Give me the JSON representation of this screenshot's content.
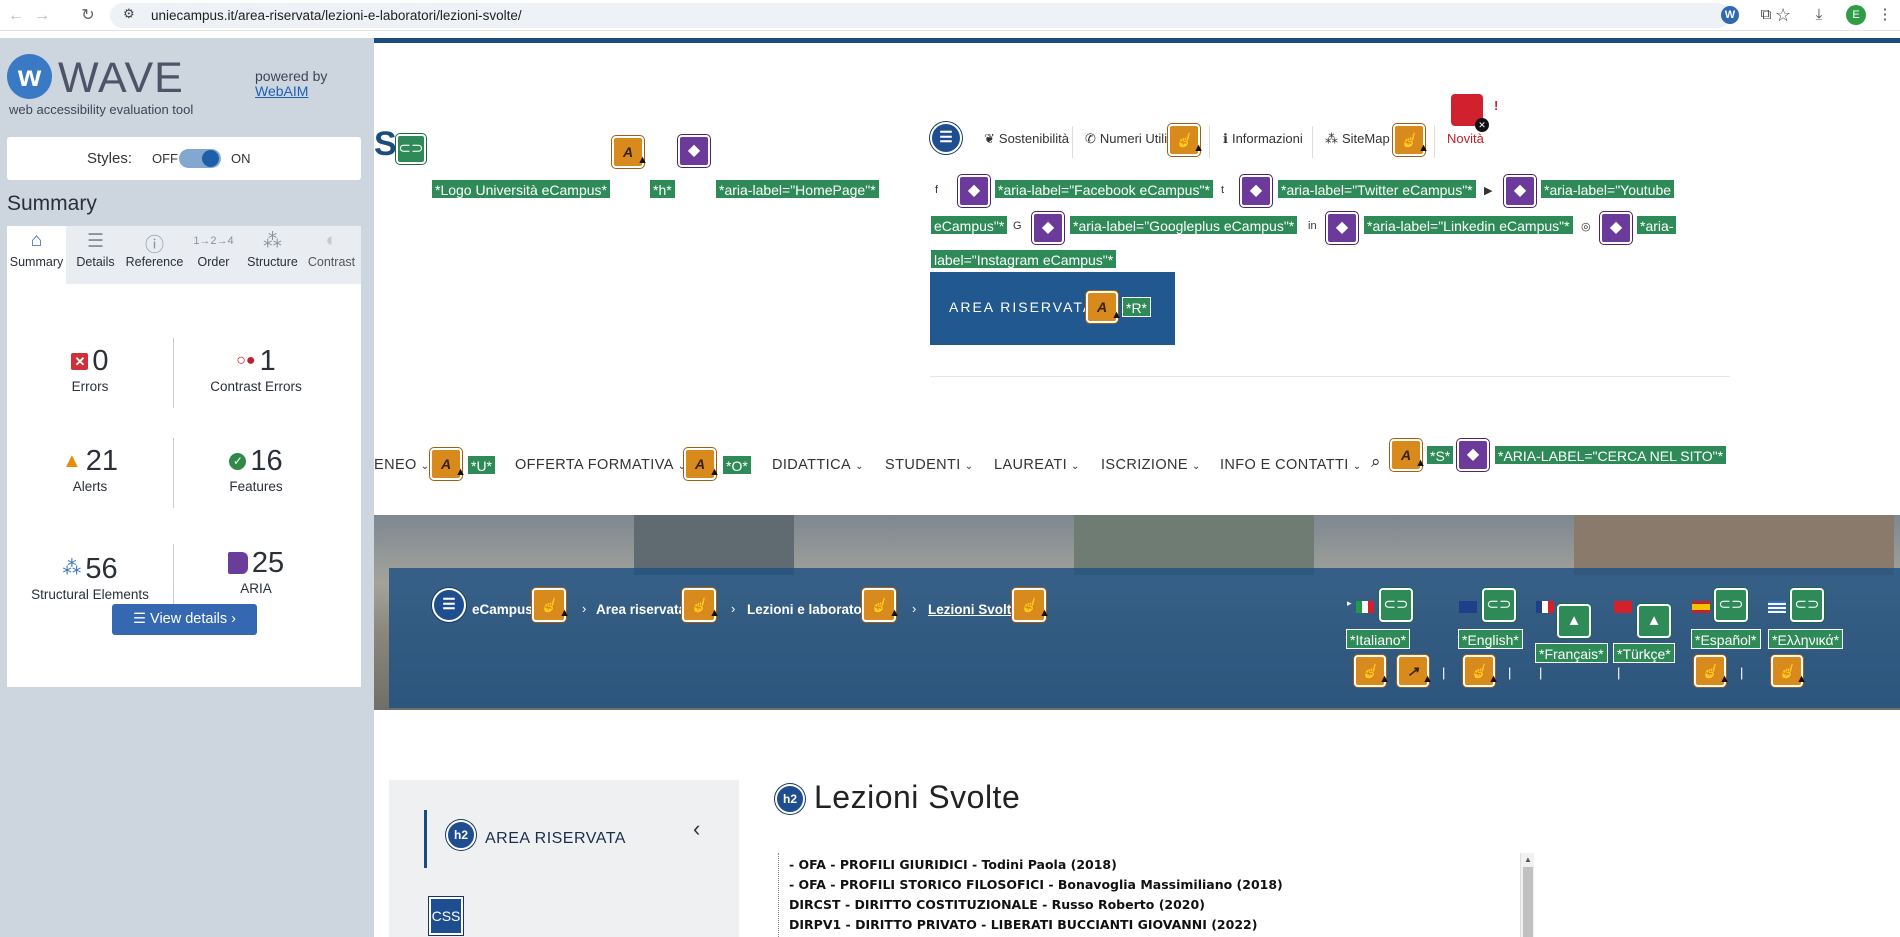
{
  "browser": {
    "url": "uniecampus.it/area-riservata/lezioni-e-laboratori/lezioni-svolte/",
    "avatar_letter": "E"
  },
  "wave": {
    "brand": "WAVE",
    "tagline": "web accessibility evaluation tool",
    "powered_by": "powered by",
    "webaim": "WebAIM",
    "styles_label": "Styles:",
    "styles_off": "OFF",
    "styles_on": "ON",
    "summary_title": "Summary",
    "tabs": [
      {
        "label": "Summary",
        "icon": "home-icon"
      },
      {
        "label": "Details",
        "icon": "list-icon"
      },
      {
        "label": "Reference",
        "icon": "info-icon"
      },
      {
        "label": "Order",
        "icon": "order-icon"
      },
      {
        "label": "Structure",
        "icon": "structure-icon"
      },
      {
        "label": "Contrast",
        "icon": "contrast-icon"
      }
    ],
    "stats": {
      "errors": {
        "value": "0",
        "label": "Errors"
      },
      "contrast": {
        "value": "1",
        "label": "Contrast Errors"
      },
      "alerts": {
        "value": "21",
        "label": "Alerts"
      },
      "features": {
        "value": "16",
        "label": "Features"
      },
      "structural": {
        "value": "56",
        "label": "Structural Elements"
      },
      "aria": {
        "value": "25",
        "label": "ARIA"
      }
    },
    "view_details": "View details ›"
  },
  "site": {
    "logo_letter": "S",
    "logo_alt": "*Logo Università eCampus*",
    "h_tag": "*h*",
    "home_aria": "*aria-label=\"HomePage\"*",
    "util_links": [
      "Sostenibilità",
      "Numeri Utili",
      "Informazioni",
      "SiteMap"
    ],
    "novita": "Novità",
    "excl": "!",
    "social": [
      "*aria-label=\"Facebook eCampus\"*",
      "*aria-label=\"Twitter eCampus\"*",
      "*aria-label=\"Youtube",
      "eCampus\"*",
      "*aria-label=\"Googleplus eCampus\"*",
      "*aria-label=\"Linkedin eCampus\"*",
      "*aria-",
      "label=\"Instagram eCampus\"*"
    ],
    "area_button": "AREA RISERVATA",
    "area_r": "*R*",
    "menu": [
      {
        "label": "ENEO",
        "tag": "*U*"
      },
      {
        "label": "OFFERTA FORMATIVA",
        "tag": "*O*"
      },
      {
        "label": "DIDATTICA"
      },
      {
        "label": "STUDENTI"
      },
      {
        "label": "LAUREATI"
      },
      {
        "label": "ISCRIZIONE"
      },
      {
        "label": "INFO E CONTATTI"
      }
    ],
    "search_tag": "*S*",
    "search_aria": "*ARIA-LABEL=\"CERCA NEL SITO\"*",
    "breadcrumbs": [
      "eCampus",
      "Area riservata",
      "Lezioni e laboratori",
      "Lezioni Svolte"
    ],
    "languages": [
      "*Italiano*",
      "*English*",
      "*Français*",
      "*Türkçe*",
      "*Español*",
      "*Ελληνικά*"
    ],
    "sidebar_title": "AREA RISERVATA",
    "h2": "h2",
    "css_tag": "CSS",
    "page_title": "Lezioni Svolte",
    "lessons": [
      "- OFA - PROFILI GIURIDICI - Todini Paola (2018)",
      "- OFA - PROFILI STORICO FILOSOFICI - Bonavoglia Massimiliano (2018)",
      "DIRCST - DIRITTO COSTITUZIONALE - Russo Roberto (2020)",
      "DIRPV1 - DIRITTO PRIVATO - LIBERATI BUCCIANTI GIOVANNI (2022)"
    ]
  }
}
